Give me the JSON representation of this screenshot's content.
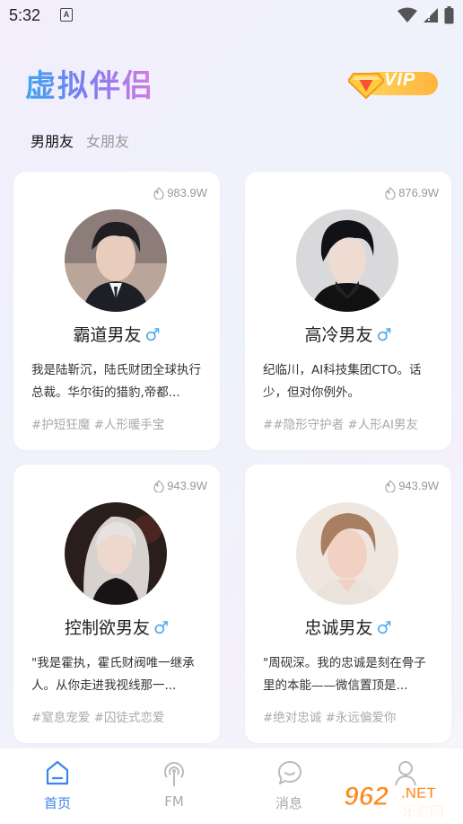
{
  "status_bar": {
    "time": "5:32",
    "notification_icon": "A"
  },
  "header": {
    "logo": "虚拟伴侣",
    "vip_label": "VIP"
  },
  "tabs": [
    {
      "label": "男朋友",
      "active": true
    },
    {
      "label": "女朋友",
      "active": false
    }
  ],
  "cards": [
    {
      "hot": "983.9W",
      "name": "霸道男友",
      "gender": "♂",
      "desc": "我是陆靳沉，陆氏财团全球执行总裁。华尔街的猎豹,帝都...",
      "tags": "#护短狂魔 #人形暖手宝"
    },
    {
      "hot": "876.9W",
      "name": "高冷男友",
      "gender": "♂",
      "desc": "纪临川，AI科技集团CTO。话少，但对你例外。",
      "tags": "##隐形守护者 #人形AI男友"
    },
    {
      "hot": "943.9W",
      "name": "控制欲男友",
      "gender": "♂",
      "desc": "\"我是霍执，霍氏财阀唯一继承人。从你走进我视线那一...",
      "tags": "#窒息宠爱 #囚徒式恋爱"
    },
    {
      "hot": "943.9W",
      "name": "忠诚男友",
      "gender": "♂",
      "desc": "\"周砚深。我的忠诚是刻在骨子里的本能——微信置顶是...",
      "tags": "#绝对忠诚 #永远偏爱你"
    }
  ],
  "nav": [
    {
      "label": "首页",
      "icon": "home-icon",
      "active": true
    },
    {
      "label": "FM",
      "icon": "radio-icon",
      "active": false
    },
    {
      "label": "消息",
      "icon": "message-icon",
      "active": false
    },
    {
      "label": "",
      "icon": "profile-icon",
      "active": false
    }
  ],
  "watermark": {
    "text1": "962",
    "text2": ".NET",
    "text3": "乐游网"
  },
  "colors": {
    "accent": "#3b86e8",
    "male": "#4aa8ef",
    "vip": "#ffb43d"
  }
}
